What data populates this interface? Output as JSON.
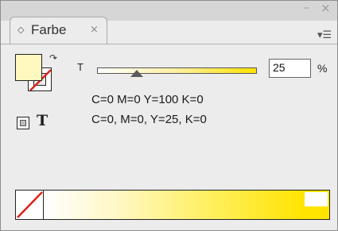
{
  "window": {
    "minimize_label": "–",
    "close_label": "×"
  },
  "tab": {
    "arrows_glyph": "◇",
    "label": "Farbe",
    "close_label": "×"
  },
  "panel_menu": {
    "icon": "panel-menu-icon",
    "glyph": "▾☰"
  },
  "swatches": {
    "fill_color": "#fff8bf",
    "stroke": "none",
    "swap_glyph": "↷"
  },
  "formatting": {
    "text_glyph": "T"
  },
  "tint": {
    "label": "T",
    "value": "25",
    "unit": "%",
    "level": 0.25
  },
  "color_info": {
    "line1": "C=0 M=0 Y=100 K=0",
    "line2": "C=0, M=0, Y=25, K=0"
  },
  "ramp": {
    "colors": [
      "#ffffff",
      "#ffe400"
    ]
  }
}
